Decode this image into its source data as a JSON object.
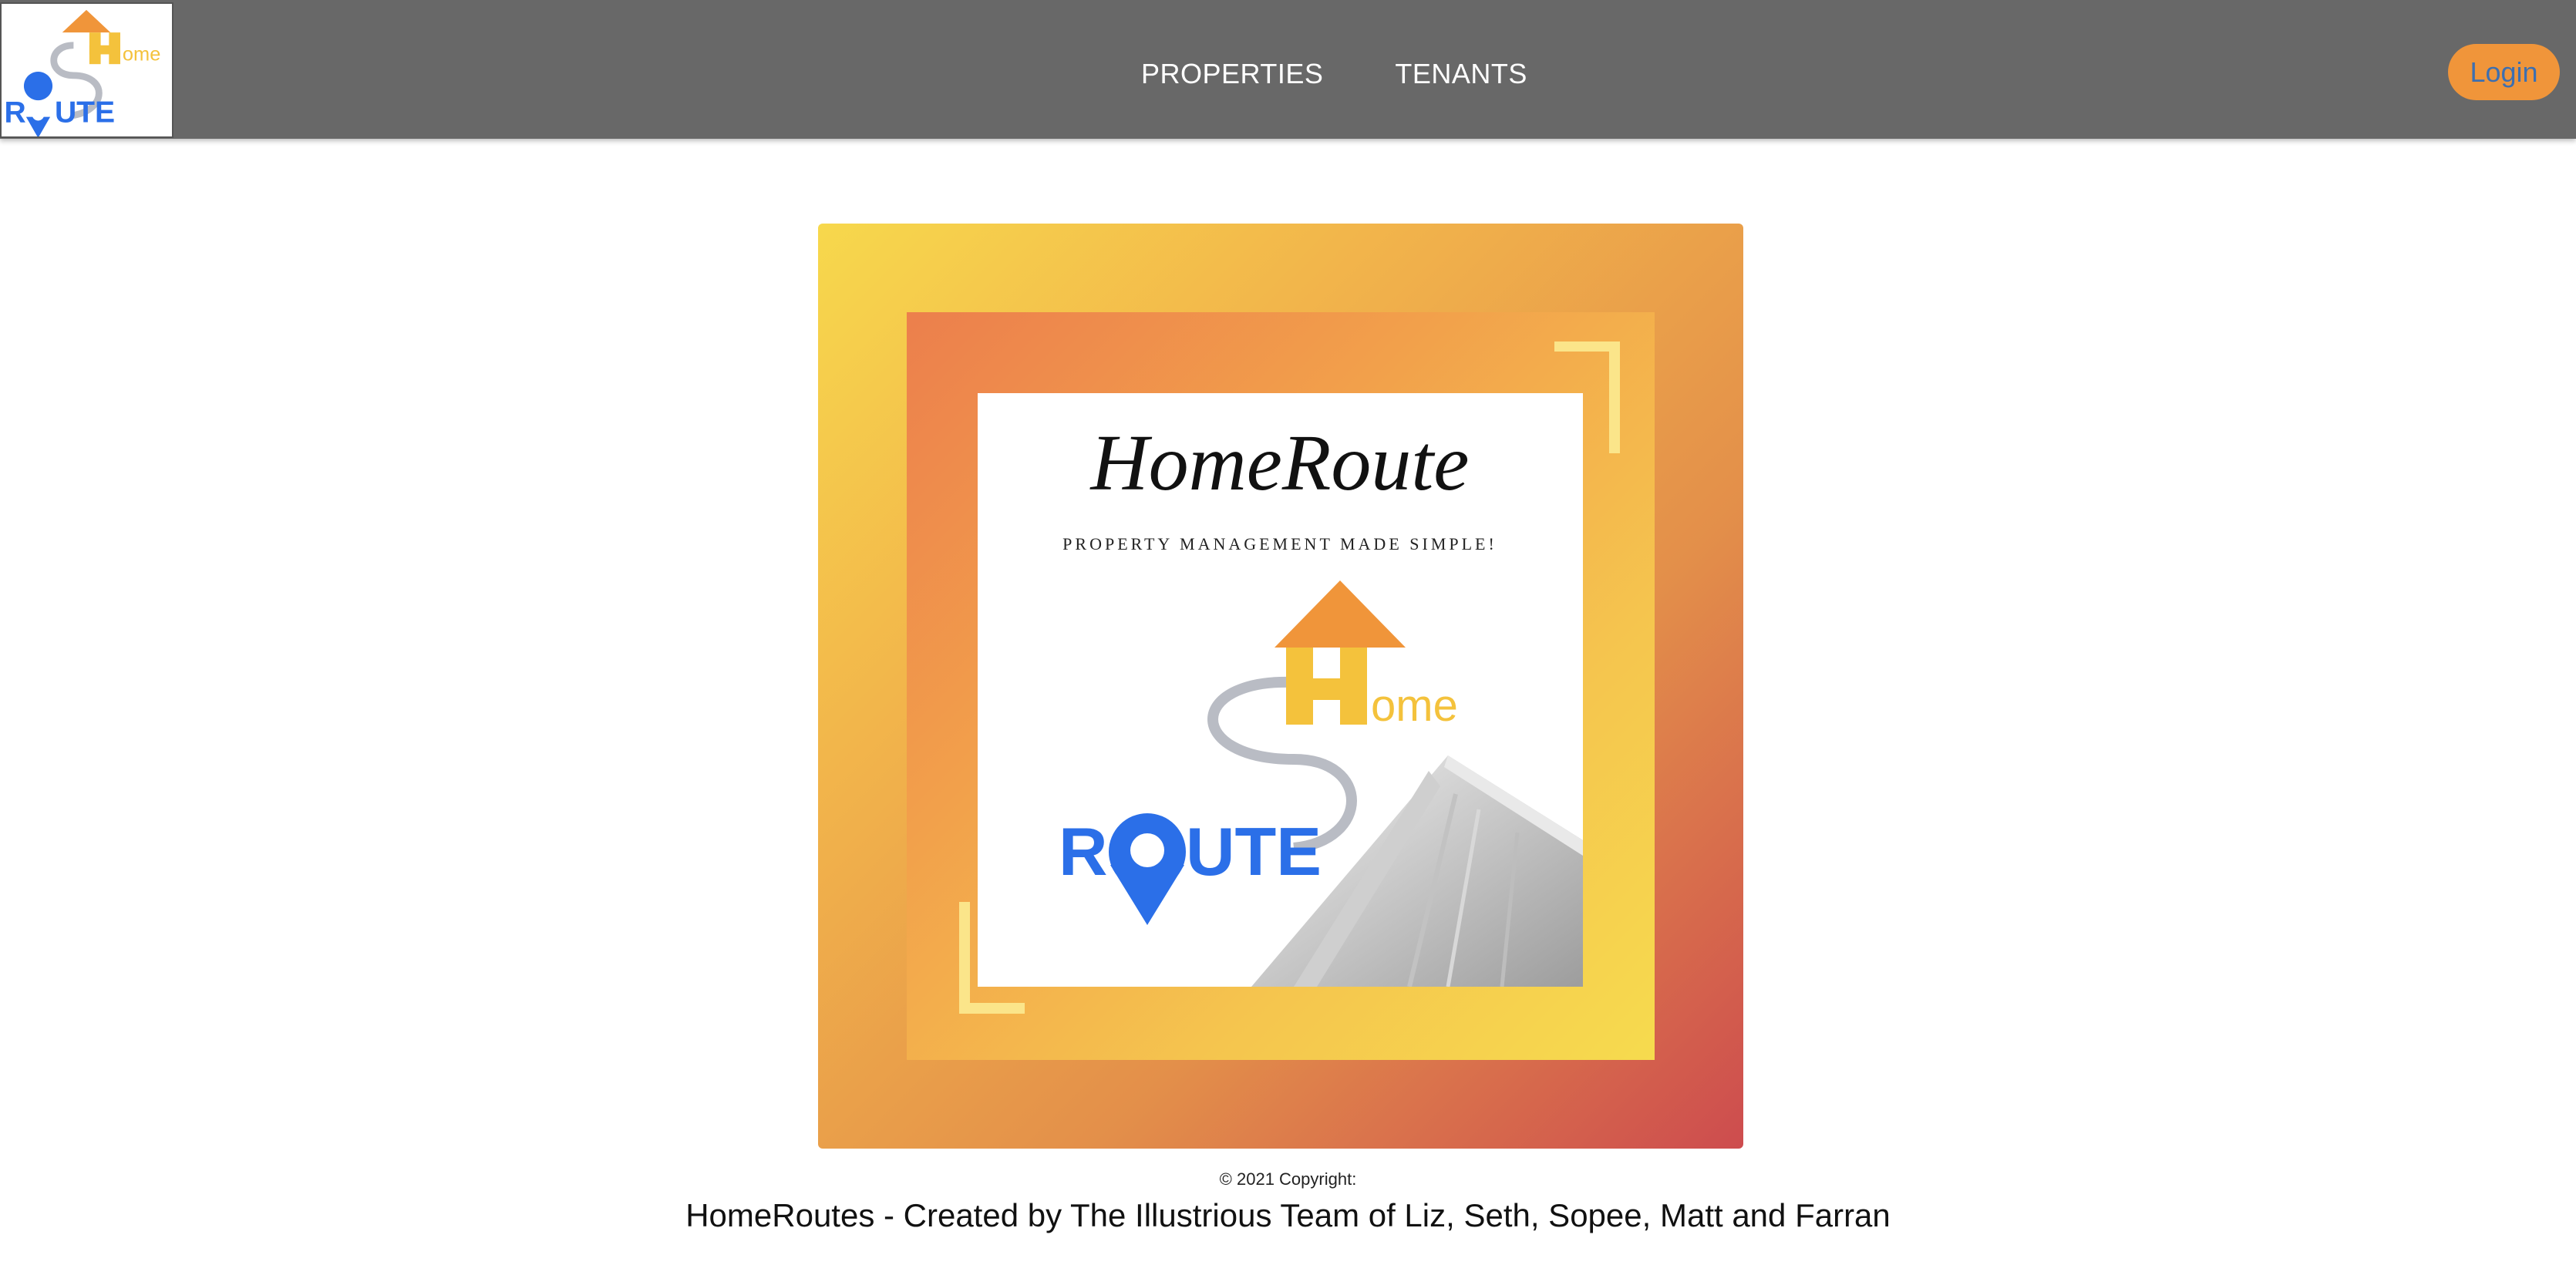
{
  "navbar": {
    "logo": {
      "wordmark_top": "ome",
      "wordmark_bottom_left": "R",
      "wordmark_bottom_right": "UTE"
    },
    "links": [
      {
        "label": "PROPERTIES"
      },
      {
        "label": "TENANTS"
      }
    ],
    "login_label": "Login"
  },
  "hero": {
    "title": "HomeRoute",
    "tagline": "PROPERTY MANAGEMENT MADE SIMPLE!",
    "logo_home_text": "ome",
    "logo_route_r": "R",
    "logo_route_rest": "UTE"
  },
  "footer": {
    "copyright": "© 2021 Copyright:",
    "credit": "HomeRoutes - Created by The Illustrious Team of Liz, Seth, Sopee, Matt and Farran"
  },
  "colors": {
    "navbar": "#686868",
    "login_button": "#f0953a",
    "login_text": "#3d6fb0",
    "brand_blue": "#2b6fe8",
    "brand_orange": "#f0953a",
    "brand_yellow": "#f4c23c"
  }
}
